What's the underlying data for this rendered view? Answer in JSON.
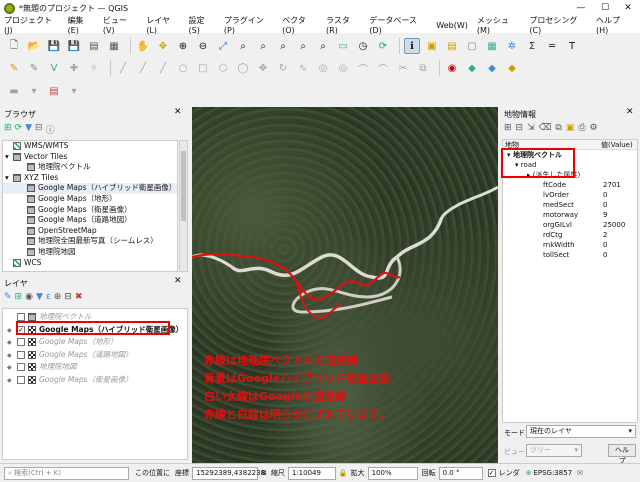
{
  "window": {
    "title": "*無題のプロジェクト — QGIS",
    "minimize": "—",
    "maximize": "☐",
    "close": "✕"
  },
  "menu": [
    "プロジェクト(J)",
    "編集(E)",
    "ビュー(V)",
    "レイヤ(L)",
    "設定(S)",
    "プラグイン(P)",
    "ベクタ(O)",
    "ラスタ(R)",
    "データベース(D)",
    "Web(W)",
    "メッシュ(M)",
    "プロセシング(C)",
    "ヘルプ(H)"
  ],
  "browser": {
    "title": "ブラウザ",
    "items": [
      {
        "label": "WMS/WMTS",
        "indent": 0,
        "icon": "globe-icon"
      },
      {
        "label": "Vector Tiles",
        "indent": 0,
        "icon": "grid-icon",
        "expander": "▾"
      },
      {
        "label": "地理院ベクトル",
        "indent": 1,
        "icon": "grid-icon"
      },
      {
        "label": "XYZ Tiles",
        "indent": 0,
        "icon": "grid-icon",
        "expander": "▾"
      },
      {
        "label": "Google Maps（ハイブリッド衛星画像）",
        "indent": 1,
        "icon": "grid-icon",
        "selected": true
      },
      {
        "label": "Google Maps（地形）",
        "indent": 1,
        "icon": "grid-icon"
      },
      {
        "label": "Google Maps（衛星画像）",
        "indent": 1,
        "icon": "grid-icon"
      },
      {
        "label": "Google Maps（道路地図）",
        "indent": 1,
        "icon": "grid-icon"
      },
      {
        "label": "OpenStreetMap",
        "indent": 1,
        "icon": "grid-icon"
      },
      {
        "label": "地理院全国最新写真（シームレス）",
        "indent": 1,
        "icon": "grid-icon"
      },
      {
        "label": "地理院地図",
        "indent": 1,
        "icon": "grid-icon"
      },
      {
        "label": "WCS",
        "indent": 0,
        "icon": "globe-icon"
      }
    ]
  },
  "layers": {
    "title": "レイヤ",
    "items": [
      {
        "label": "地理院ベクトル",
        "checked": false,
        "dim": true
      },
      {
        "label": "Google Maps（ハイブリッド衛星画像）",
        "checked": true,
        "dim": false
      },
      {
        "label": "Google Maps（地形）",
        "checked": false,
        "dim": true
      },
      {
        "label": "Google Maps（道路地図）",
        "checked": false,
        "dim": true
      },
      {
        "label": "地理院地図",
        "checked": false,
        "dim": true
      },
      {
        "label": "Google Maps（衛星画像）",
        "checked": false,
        "dim": true
      }
    ]
  },
  "map_annotation": [
    "赤線は地理院ベクトルの道路線",
    "背景はGoogleハイブリッド衛星画像",
    "白い太線はGoogleの道路線",
    "赤線と白線は明らかにずれています。"
  ],
  "identify": {
    "title": "地物情報",
    "col_feature": "地物",
    "col_value": "値(Value)",
    "layer": "地理院ベクトル",
    "sublayer": "road",
    "derived": "(派生した属性)",
    "attributes": [
      {
        "key": "ftCode",
        "value": "2701"
      },
      {
        "key": "lvOrder",
        "value": "0"
      },
      {
        "key": "medSect",
        "value": "0"
      },
      {
        "key": "motorway",
        "value": "9"
      },
      {
        "key": "orgGILvl",
        "value": "25000"
      },
      {
        "key": "rdCtg",
        "value": "2"
      },
      {
        "key": "rnkWidth",
        "value": "0"
      },
      {
        "key": "tollSect",
        "value": "0"
      }
    ],
    "mode_label": "モード",
    "mode_value": "現在のレイヤ",
    "view_label": "ビュー",
    "view_value": "ツリー",
    "help": "ヘルプ"
  },
  "status": {
    "search_placeholder": "検索(Ctrl + K)",
    "coord_label": "この位置に",
    "coord_label2": "座標",
    "coord_value": "15292389,4382238",
    "scale_label": "縮尺",
    "scale_value": "1:10049",
    "magnifier_label": "拡大",
    "magnifier_value": "100%",
    "rotation_label": "回転",
    "rotation_value": "0.0 °",
    "render_label": "レンダ",
    "crs": "EPSG:3857"
  }
}
